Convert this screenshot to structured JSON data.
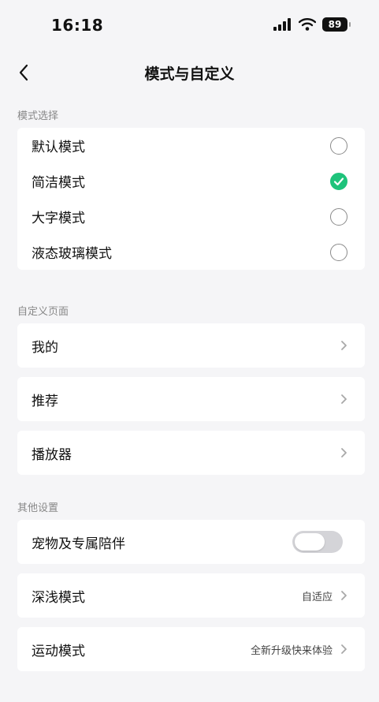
{
  "status_bar": {
    "time": "16:18",
    "battery": "89"
  },
  "header": {
    "title": "模式与自定义"
  },
  "sections": {
    "mode": {
      "title": "模式选择",
      "items": [
        {
          "label": "默认模式",
          "selected": false
        },
        {
          "label": "简洁模式",
          "selected": true
        },
        {
          "label": "大字模式",
          "selected": false
        },
        {
          "label": "液态玻璃模式",
          "selected": false
        }
      ]
    },
    "custom": {
      "title": "自定义页面",
      "items": [
        {
          "label": "我的"
        },
        {
          "label": "推荐"
        },
        {
          "label": "播放器"
        }
      ]
    },
    "other": {
      "title": "其他设置",
      "pet": {
        "label": "宠物及专属陪伴",
        "enabled": false
      },
      "depth": {
        "label": "深浅模式",
        "value": "自适应"
      },
      "sport": {
        "label": "运动模式",
        "value": "全新升级快来体验"
      }
    }
  },
  "colors": {
    "accent": "#1ec37b",
    "background": "#f5f5f7",
    "card": "#ffffff"
  }
}
